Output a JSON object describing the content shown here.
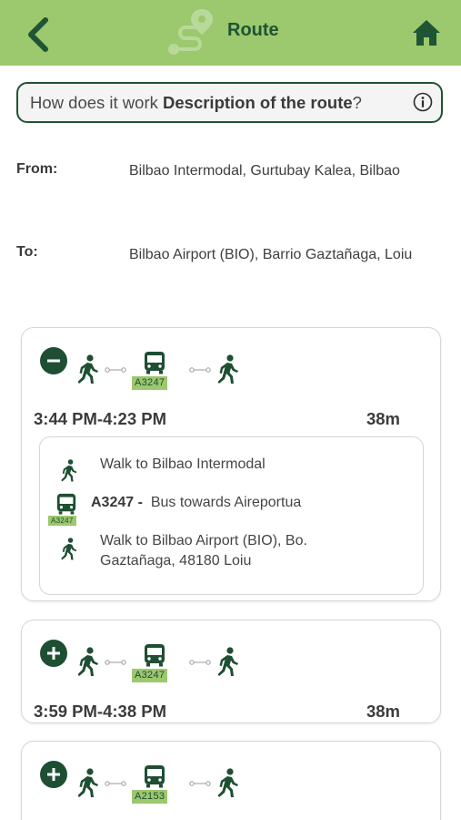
{
  "header": {
    "title": "Route",
    "back_icon": "chevron-left-icon",
    "logo_icon": "route-icon",
    "home_icon": "home-icon"
  },
  "info": {
    "prefix": "How does it work",
    "bold": "Description of the route",
    "suffix": "?",
    "icon": "info-icon"
  },
  "from": {
    "label": "From:",
    "value": "Bilbao Intermodal, Gurtubay Kalea, Bilbao"
  },
  "to": {
    "label": "To:",
    "value": "Bilbao Airport (BIO), Barrio Gaztañaga, Loiu"
  },
  "routes": [
    {
      "expanded": true,
      "line": "A3247",
      "time": "3:44 PM-4:23 PM",
      "duration": "38m",
      "steps": [
        {
          "type": "walk",
          "text": "Walk to Bilbao Intermodal"
        },
        {
          "type": "bus",
          "line": "A3247",
          "line_text": "A3247 -",
          "text": "Bus towards Aireportua"
        },
        {
          "type": "walk",
          "text_line1": "Walk to Bilbao Airport (BIO), Bo.",
          "text_line2": "Gaztañaga, 48180 Loiu"
        }
      ]
    },
    {
      "expanded": false,
      "line": "A3247",
      "time": "3:59 PM-4:38 PM",
      "duration": "38m"
    },
    {
      "expanded": false,
      "line": "A2153"
    }
  ],
  "colors": {
    "header": "#9cc86e",
    "dark_green": "#1e4f33",
    "badge": "#9cc86e"
  }
}
